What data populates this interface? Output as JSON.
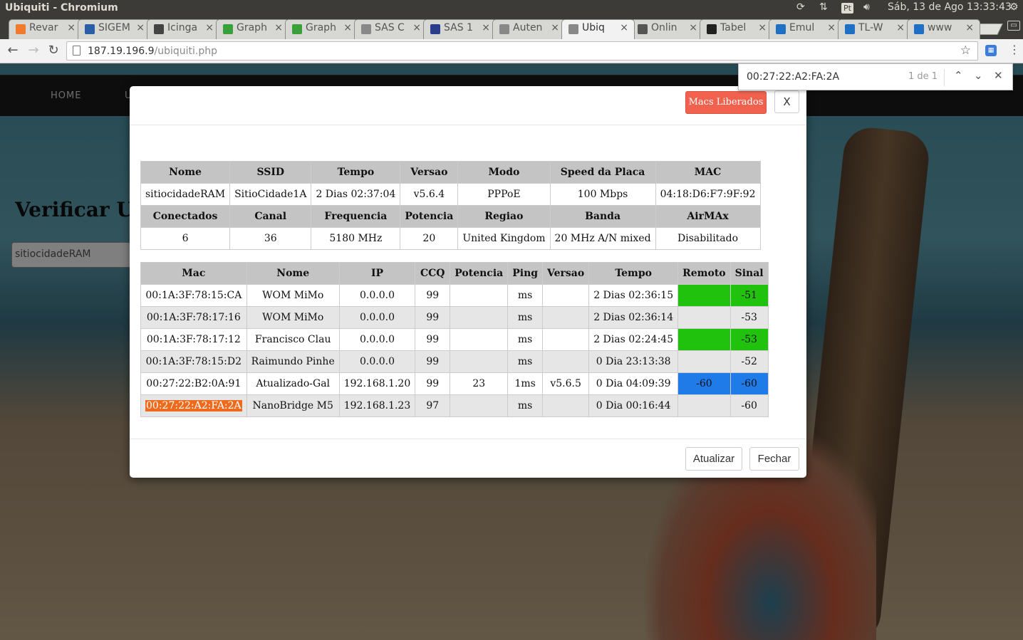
{
  "window": {
    "title": "Ubiquiti - Chromium"
  },
  "system_tray": {
    "input_method": "Pt",
    "datetime": "Sáb, 13 de Ago 13:33:43"
  },
  "tabs": [
    {
      "label": "Revar",
      "color": "#f07a2e"
    },
    {
      "label": "SIGEM",
      "color": "#2a5fa8"
    },
    {
      "label": "Icinga",
      "color": "#444444"
    },
    {
      "label": "Graph",
      "color": "#3aa03a"
    },
    {
      "label": "Graph",
      "color": "#3aa03a"
    },
    {
      "label": "SAS C",
      "color": "#888888"
    },
    {
      "label": "SAS 1",
      "color": "#2a3e8c"
    },
    {
      "label": "Auten",
      "color": "#888888"
    },
    {
      "label": "Ubiq",
      "color": "#888888"
    },
    {
      "label": "Onlin",
      "color": "#555555"
    },
    {
      "label": "Tabel",
      "color": "#222222"
    },
    {
      "label": "Emul",
      "color": "#1f6fc5"
    },
    {
      "label": "TL-W",
      "color": "#1f6fc5"
    },
    {
      "label": "www",
      "color": "#1f6fc5"
    }
  ],
  "addressbar": {
    "host": "187.19.196.9",
    "path": "/ubiquiti.php"
  },
  "findbar": {
    "query": "00:27:22:A2:FA:2A",
    "count": "1 de 1"
  },
  "site": {
    "nav_home": "HOME",
    "nav_2": "U",
    "title": "Verificar Ub",
    "input_value": "sitiocidadeRAM"
  },
  "modal": {
    "macs_button": "Macs Liberados",
    "close_x": "X",
    "info_headers_1": [
      "Nome",
      "SSID",
      "Tempo",
      "Versao",
      "Modo",
      "Speed da Placa",
      "MAC"
    ],
    "info_values_1": [
      "sitiocidadeRAM",
      "SitioCidade1A",
      "2 Dias 02:37:04",
      "v5.6.4",
      "PPPoE",
      "100 Mbps",
      "04:18:D6:F7:9F:92"
    ],
    "info_headers_2": [
      "Conectados",
      "Canal",
      "Frequencia",
      "Potencia",
      "Regiao",
      "Banda",
      "AirMAx"
    ],
    "info_values_2": [
      "6",
      "36",
      "5180 MHz",
      "20",
      "United Kingdom",
      "20 MHz A/N mixed",
      "Disabilitado"
    ],
    "clients_headers": [
      "Mac",
      "Nome",
      "IP",
      "CCQ",
      "Potencia",
      "Ping",
      "Versao",
      "Tempo",
      "Remoto",
      "Sinal"
    ],
    "clients": [
      {
        "mac": "00:1A:3F:78:15:CA",
        "nome": "WOM MiMo",
        "ip": "0.0.0.0",
        "ccq": "99",
        "potencia": "",
        "ping": "ms",
        "versao": "",
        "tempo": "2 Dias 02:36:15",
        "remoto": "",
        "sinal": "-51"
      },
      {
        "mac": "00:1A:3F:78:17:16",
        "nome": "WOM MiMo",
        "ip": "0.0.0.0",
        "ccq": "99",
        "potencia": "",
        "ping": "ms",
        "versao": "",
        "tempo": "2 Dias 02:36:14",
        "remoto": "",
        "sinal": "-53"
      },
      {
        "mac": "00:1A:3F:78:17:12",
        "nome": "Francisco Clau",
        "ip": "0.0.0.0",
        "ccq": "99",
        "potencia": "",
        "ping": "ms",
        "versao": "",
        "tempo": "2 Dias 02:24:45",
        "remoto": "",
        "sinal": "-53"
      },
      {
        "mac": "00:1A:3F:78:15:D2",
        "nome": "Raimundo Pinhe",
        "ip": "0.0.0.0",
        "ccq": "99",
        "potencia": "",
        "ping": "ms",
        "versao": "",
        "tempo": "0 Dia 23:13:38",
        "remoto": "",
        "sinal": "-52"
      },
      {
        "mac": "00:27:22:B2:0A:91",
        "nome": "Atualizado-Gal",
        "ip": "192.168.1.20",
        "ccq": "99",
        "potencia": "23",
        "ping": "1ms",
        "versao": "v5.6.5",
        "tempo": "0 Dia 04:09:39",
        "remoto": "-60",
        "sinal": "-60"
      },
      {
        "mac": "00:27:22:A2:FA:2A",
        "nome": "NanoBridge M5",
        "ip": "192.168.1.23",
        "ccq": "97",
        "potencia": "",
        "ping": "ms",
        "versao": "",
        "tempo": "0 Dia 00:16:44",
        "remoto": "",
        "sinal": "-60"
      }
    ],
    "atualizar_button": "Atualizar",
    "fechar_button": "Fechar"
  },
  "colors": {
    "signal_good": "#20c20e",
    "signal_blue": "#1e7be8",
    "find_highlight": "#ee6b1e",
    "macs_button": "#f0624e"
  }
}
